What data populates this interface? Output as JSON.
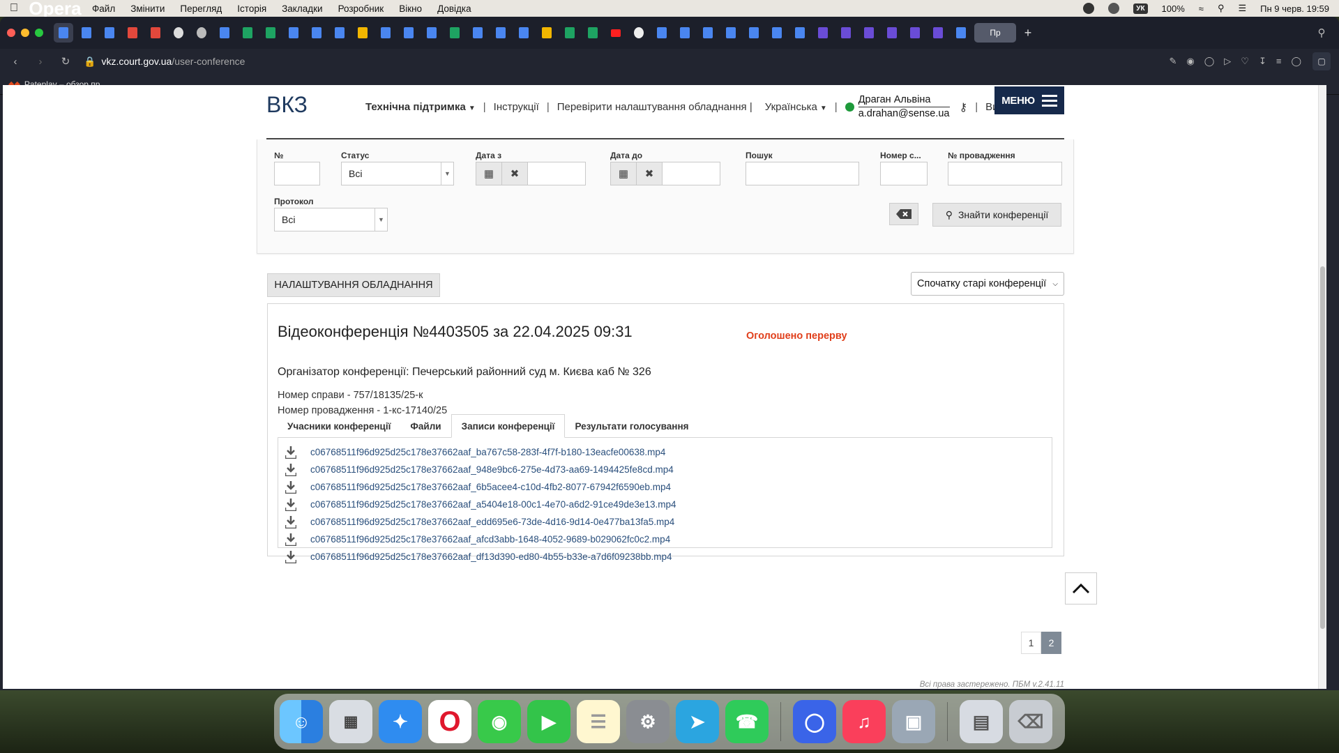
{
  "menubar": {
    "app_name": "Opera",
    "items": [
      "Файл",
      "Змінити",
      "Перегляд",
      "Історія",
      "Закладки",
      "Розробник",
      "Вікно",
      "Довідка"
    ],
    "keyboard": "УК",
    "battery": "100%",
    "datetime": "Пн 9 черв. 19:59"
  },
  "browser": {
    "url_host": "vkz.court.gov.ua",
    "url_path": "/user-conference",
    "last_tab_label": "Пр",
    "bookmark": "Pateplay – обзор пр..."
  },
  "header": {
    "logo": "ВКЗ",
    "support": "Технічна підтримка",
    "instructions": "Інструкції",
    "check_equipment": "Перевірити налаштування обладнання",
    "language": "Українська",
    "user_name": "Драган Альвіна",
    "user_email": "a.drahan@sense.ua",
    "logout": "Вийти",
    "menu": "МЕНЮ"
  },
  "filters": {
    "number_label": "№",
    "status_label": "Статус",
    "status_value": "Всі",
    "date_from_label": "Дата з",
    "date_to_label": "Дата до",
    "search_label": "Пошук",
    "room_label": "Номер с...",
    "proceeding_label": "№ провадження",
    "protocol_label": "Протокол",
    "protocol_value": "Всі",
    "find_button": "Знайти конференції"
  },
  "actions": {
    "equipment_button": "НАЛАШТУВАННЯ ОБЛАДНАННЯ",
    "sort_value": "Спочатку старі конференції"
  },
  "conference": {
    "title": "Відеоконференція №4403505 за 22.04.2025 09:31",
    "status": "Оголошено перерву",
    "organizer": "Організатор конференції: Печерський районний суд м. Києва каб № 326",
    "case_number": "Номер справи - 757/18135/25-к",
    "proceeding_number": "Номер провадження - 1-кс-17140/25",
    "tabs": [
      "Учасники конференції",
      "Файли",
      "Записи конференції",
      "Результати голосування"
    ],
    "active_tab_index": 2,
    "recordings": [
      "c06768511f96d925d25c178e37662aaf_ba767c58-283f-4f7f-b180-13eacfe00638.mp4",
      "c06768511f96d925d25c178e37662aaf_948e9bc6-275e-4d73-aa69-1494425fe8cd.mp4",
      "c06768511f96d925d25c178e37662aaf_6b5acee4-c10d-4fb2-8077-67942f6590eb.mp4",
      "c06768511f96d925d25c178e37662aaf_a5404e18-00c1-4e70-a6d2-91ce49de3e13.mp4",
      "c06768511f96d925d25c178e37662aaf_edd695e6-73de-4d16-9d14-0e477ba13fa5.mp4",
      "c06768511f96d925d25c178e37662aaf_afcd3abb-1648-4052-9689-b029062fc0c2.mp4",
      "c06768511f96d925d25c178e37662aaf_df13d390-ed80-4b55-b33e-a7d6f09238bb.mp4"
    ]
  },
  "pagination": {
    "pages": [
      "1",
      "2"
    ],
    "current": "2"
  },
  "footer": "Всі права застережено. ПБМ v.2.41.11",
  "colors": {
    "brand_navy": "#16294b",
    "status_red": "#e03e1a",
    "online_green": "#1e9a3b",
    "link_blue": "#2a4f7c"
  }
}
